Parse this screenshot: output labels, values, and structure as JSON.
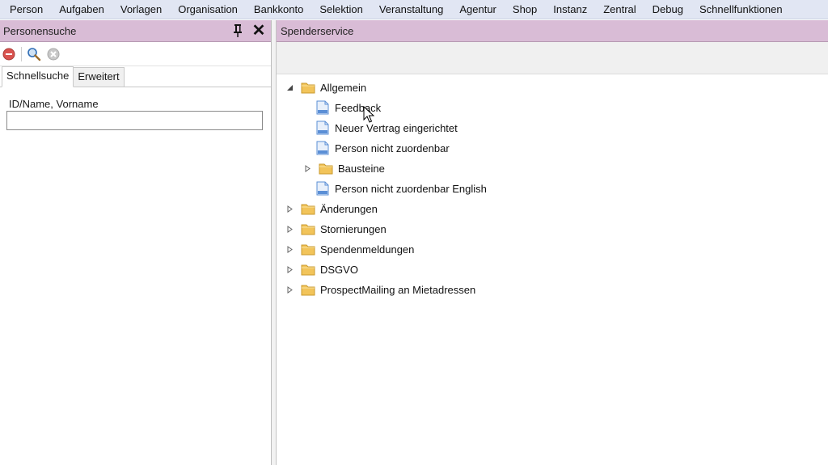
{
  "menu": [
    "Person",
    "Aufgaben",
    "Vorlagen",
    "Organisation",
    "Bankkonto",
    "Selektion",
    "Veranstaltung",
    "Agentur",
    "Shop",
    "Instanz",
    "Zentral",
    "Debug",
    "Schnellfunktionen"
  ],
  "left_panel": {
    "title": "Personensuche",
    "tabs": [
      "Schnellsuche",
      "Erweitert"
    ],
    "field_label": "ID/Name, Vorname",
    "field_value": ""
  },
  "right_panel": {
    "title": "Spenderservice",
    "tree": [
      {
        "label": "Allgemein",
        "type": "folder",
        "expanded": true,
        "level": 0
      },
      {
        "label": "Feedback",
        "type": "document",
        "level": 1
      },
      {
        "label": "Neuer Vertrag eingerichtet",
        "type": "document",
        "level": 1
      },
      {
        "label": "Person nicht zuordenbar",
        "type": "document",
        "level": 1
      },
      {
        "label": "Bausteine",
        "type": "folder",
        "expanded": false,
        "level": 1
      },
      {
        "label": "Person nicht zuordenbar English",
        "type": "document",
        "level": 1
      },
      {
        "label": "Änderungen",
        "type": "folder",
        "expanded": false,
        "level": 0
      },
      {
        "label": "Stornierungen",
        "type": "folder",
        "expanded": false,
        "level": 0
      },
      {
        "label": "Spendenmeldungen",
        "type": "folder",
        "expanded": false,
        "level": 0
      },
      {
        "label": "DSGVO",
        "type": "folder",
        "expanded": false,
        "level": 0
      },
      {
        "label": "ProspectMailing an Mietadressen",
        "type": "folder",
        "expanded": false,
        "level": 0
      }
    ]
  },
  "colors": {
    "menubar": "#e1e6f3",
    "panel_header": "#d9bcd6",
    "folder": "#f2c45a",
    "document": "#5b8fd6"
  },
  "icons": {
    "toolbar": [
      "cancel-icon",
      "search-icon",
      "clear-icon"
    ],
    "header": [
      "pin-icon",
      "close-icon"
    ]
  }
}
